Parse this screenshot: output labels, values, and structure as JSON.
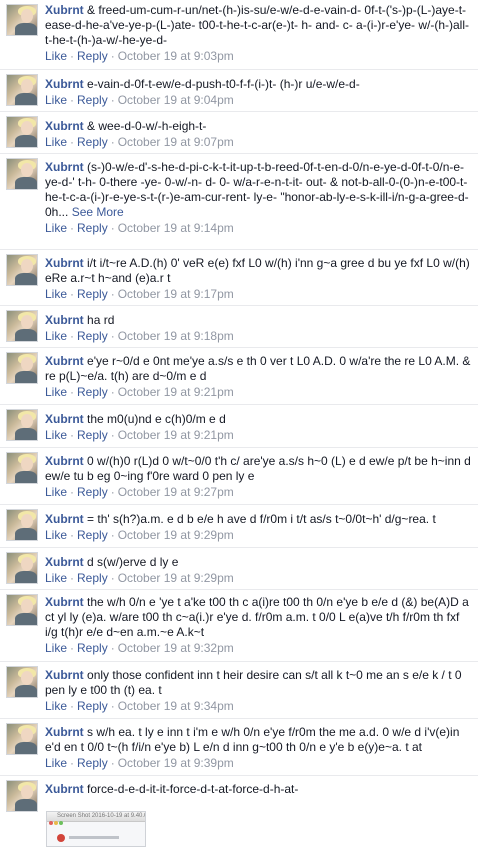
{
  "meta_labels": {
    "like": "Like",
    "reply": "Reply",
    "separator": "·"
  },
  "comments": [
    {
      "author": "Xubrnt",
      "text": "& freed-um-cum-r-un/net-(h-)is-su/e-w/e-d-e-vain-d- 0f-t-('s-)p-(L-)aye-t-ease-d-he-a've-ye-p-(L-)ate- t00-t-he-t-c-ar(e-)t- h- and- c- a-(i-)r-e'ye- w/-(h-)all-t-he-t-(h-)a-w/-he-ye-d-",
      "see_more": "",
      "time": "October 19 at 9:03pm"
    },
    {
      "author": "Xubrnt",
      "text": "e-vain-d-0f-t-ew/e-d-push-t0-f-f-(i-)t- (h-)r u/e-w/e-d-",
      "see_more": "",
      "time": "October 19 at 9:04pm"
    },
    {
      "author": "Xubrnt",
      "text": "& wee-d-0-w/-h-eigh-t-",
      "see_more": "",
      "time": "October 19 at 9:07pm"
    },
    {
      "author": "Xubrnt",
      "text": "(s-)0-w/e-d'-s-he-d-pi-c-k-t-it-up-t-b-reed-0f-t-en-d-0/n-e-ye-d-0f-t-0/n-e-ye-d-' t-h- 0-there -ye- 0-w/-n- d- 0- w/a-r-e-n-t-it- out- & not-b-all-0-(0-)n-e-t00-t-he-t-c-a-(i-)r-e-ye-s-t-(r-)e-am-cur-rent- ly-e- \"honor-ab-ly-e-s-k-ill-i/n-g-a-gree-d-0h...",
      "see_more": "See More",
      "time": "October 19 at 9:14pm"
    },
    {
      "author": "Xubrnt",
      "text": "i/t i/t~re A.D.(h) 0' veR e(e) fxf L0 w/(h) i'nn g~a gree d bu ye fxf L0 w/(h) eRe a.r~t h~and (e)a.r t",
      "see_more": "",
      "time": "October 19 at 9:17pm"
    },
    {
      "author": "Xubrnt",
      "text": "ha rd",
      "see_more": "",
      "time": "October 19 at 9:18pm"
    },
    {
      "author": "Xubrnt",
      "text": "e'ye r~0/d e 0nt me'ye a.s/s e th 0 ver t L0 A.D. 0 w/a're the re L0 A.M. & re p(L)~e/a. t(h) are d~0/m e d",
      "see_more": "",
      "time": "October 19 at 9:21pm"
    },
    {
      "author": "Xubrnt",
      "text": "the m0(u)nd e c(h)0/m e d",
      "see_more": "",
      "time": "October 19 at 9:21pm"
    },
    {
      "author": "Xubrnt",
      "text": "0 w/(h)0 r(L)d 0 w/t~0/0 t'h c/ are'ye a.s/s h~0 (L) e d ew/e p/t be h~inn d ew/e tu b eg 0~ing f'0re ward 0 pen ly e",
      "see_more": "",
      "time": "October 19 at 9:27pm"
    },
    {
      "author": "Xubrnt",
      "text": "= th' s(h?)a.m. e d b e/e h ave d f/r0m i t/t as/s t~0/0t~h' d/g~rea. t",
      "see_more": "",
      "time": "October 19 at 9:29pm"
    },
    {
      "author": "Xubrnt",
      "text": "d s(w/)erve d ly e",
      "see_more": "",
      "time": "October 19 at 9:29pm"
    },
    {
      "author": "Xubrnt",
      "text": "the w/h 0/n e 'ye t a'ke t00 th c a(i)re t00 th 0/n e'ye b e/e d (&) be(A)D a ct yl ly (e)a. w/are t00 th c~a(i.)r e'ye d. f/r0m a.m. t 0/0 L e(a)ve t/h f/r0m th fxf i/g t(h)r e/e d~en a.m.~e A.k~t",
      "see_more": "",
      "time": "October 19 at 9:32pm"
    },
    {
      "author": "Xubrnt",
      "text": "only those confident inn t heir desire can s/t all k t~0 me an s e/e k / t 0 pen ly e t00 th (t) ea. t",
      "see_more": "",
      "time": "October 19 at 9:34pm"
    },
    {
      "author": "Xubrnt",
      "text": "s w/h ea. t ly e inn t i'm e w/h 0/n e'ye f/r0m the me a.d. 0 w/e d i'v(e)in e'd en t 0/0 t~(h f/i/n e'ye b) L e/n d inn g~t00 th 0/n e y'e b e(y)e~a. t at",
      "see_more": "",
      "time": "October 19 at 9:39pm"
    }
  ],
  "last_comment": {
    "author": "Xubrnt",
    "text": "force-d-e-d-it-it-force-d-t-at-force-d-h-at-",
    "attachment_caption": "Screen Shot 2016-10-19 at 9.40.06 PM"
  },
  "colors": {
    "link": "#3b5998",
    "text": "#141823",
    "meta": "#9197a3",
    "divider": "#e9eaed"
  }
}
